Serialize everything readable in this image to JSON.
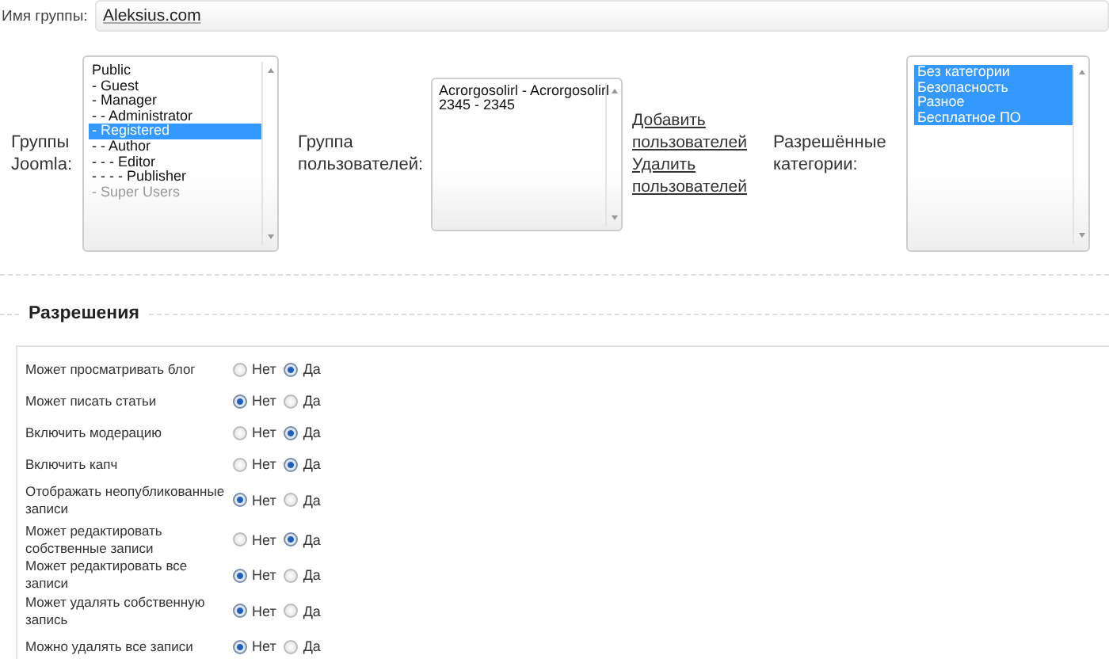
{
  "group_name": {
    "label": "Имя группы:",
    "value": "Aleksius.com"
  },
  "joomla_groups": {
    "label": "Группы Joomla:",
    "items": [
      {
        "text": "Public",
        "selected": false,
        "disabled": false
      },
      {
        "text": "- Guest",
        "selected": false,
        "disabled": false
      },
      {
        "text": "- Manager",
        "selected": false,
        "disabled": false
      },
      {
        "text": "- - Administrator",
        "selected": false,
        "disabled": false
      },
      {
        "text": "- Registered",
        "selected": true,
        "disabled": false
      },
      {
        "text": "- - Author",
        "selected": false,
        "disabled": false
      },
      {
        "text": "- - - Editor",
        "selected": false,
        "disabled": false
      },
      {
        "text": "- - - - Publisher",
        "selected": false,
        "disabled": false
      },
      {
        "text": "- Super Users",
        "selected": false,
        "disabled": true
      }
    ]
  },
  "user_group": {
    "label": "Группа пользователей:",
    "items": [
      {
        "text": "Acrorgosolirl - Acrorgosolirl",
        "selected": false,
        "disabled": false
      },
      {
        "text": "2345 - 2345",
        "selected": false,
        "disabled": false
      }
    ]
  },
  "links": [
    "Добавить пользователей",
    "Удалить пользователей"
  ],
  "categories": {
    "label": "Разрешённые категории:",
    "items": [
      {
        "text": "Без категории",
        "selected": true,
        "disabled": false
      },
      {
        "text": "Безопасность",
        "selected": true,
        "disabled": false
      },
      {
        "text": "Разное",
        "selected": true,
        "disabled": false
      },
      {
        "text": "Бесплатное ПО",
        "selected": true,
        "disabled": false
      }
    ]
  },
  "permissions": {
    "title": "Разрешения",
    "rows": [
      {
        "label": "Может просматривать блог",
        "options": [
          {
            "label": "Нет",
            "selected": false
          },
          {
            "label": "Да",
            "selected": true
          }
        ]
      },
      {
        "label": "Может писать статьи",
        "options": [
          {
            "label": "Нет",
            "selected": true
          },
          {
            "label": "Да",
            "selected": false
          }
        ]
      },
      {
        "label": "Включить модерацию",
        "options": [
          {
            "label": "Нет",
            "selected": false
          },
          {
            "label": "Да",
            "selected": true
          }
        ]
      },
      {
        "label": "Включить капч",
        "options": [
          {
            "label": "Нет",
            "selected": false
          },
          {
            "label": "Да",
            "selected": true
          }
        ]
      },
      {
        "label": "Отображать неопубликованные записи",
        "options": [
          {
            "label": "Нет",
            "selected": true
          },
          {
            "label": "Да",
            "selected": false
          }
        ]
      },
      {
        "label": "Может редактировать собственные записи",
        "options": [
          {
            "label": "Нет",
            "selected": false
          },
          {
            "label": "Да",
            "selected": true
          }
        ]
      },
      {
        "label": "Может редактировать все записи",
        "options": [
          {
            "label": "Нет",
            "selected": true
          },
          {
            "label": "Да",
            "selected": false
          }
        ]
      },
      {
        "label": "Может удалять собственную запись",
        "options": [
          {
            "label": "Нет",
            "selected": true
          },
          {
            "label": "Да",
            "selected": false
          }
        ]
      },
      {
        "label": "Можно удалять все записи",
        "options": [
          {
            "label": "Нет",
            "selected": true
          },
          {
            "label": "Да",
            "selected": false
          }
        ]
      }
    ]
  }
}
